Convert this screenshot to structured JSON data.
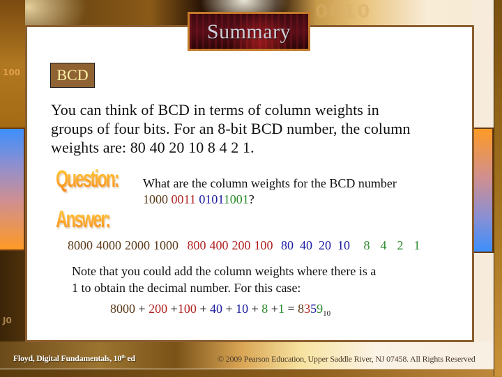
{
  "slide": {
    "title": "Summary",
    "topic_label": "BCD",
    "intro_lines": [
      "You can think of BCD in terms of column weights in",
      "groups of four bits. For an 8-bit BCD number, the column",
      "weights are: 80  40  20  10   8   4   2   1."
    ],
    "question_graphic": "Question:",
    "answer_graphic": "Answer:",
    "question": {
      "line1": "What are the column weights for the BCD number",
      "bcd_groups": [
        "1000",
        "0011",
        "0101",
        "1001"
      ],
      "suffix": "?"
    },
    "answer_weights": [
      {
        "color": "#5a3a1a",
        "values": [
          "8000",
          "4000",
          "2000",
          "1000"
        ]
      },
      {
        "color": "#b22222",
        "values": [
          "800",
          "400",
          "200",
          "100"
        ]
      },
      {
        "color": "#1a1aa0",
        "values": [
          "80",
          "40",
          "20",
          "10"
        ]
      },
      {
        "color": "#2a8a2a",
        "values": [
          "8",
          "4",
          "2",
          "1"
        ]
      }
    ],
    "note_lines": [
      "Note that you could add the column weights where there is a",
      "1 to obtain the decimal number. For this case:"
    ],
    "equation": {
      "terms": [
        {
          "text": "8000",
          "color": "#5a3a1a"
        },
        {
          "text": " + ",
          "color": "#111111"
        },
        {
          "text": "200",
          "color": "#b22222"
        },
        {
          "text": " +",
          "color": "#111111"
        },
        {
          "text": "100",
          "color": "#b22222"
        },
        {
          "text": " + ",
          "color": "#111111"
        },
        {
          "text": "40",
          "color": "#1a1aa0"
        },
        {
          "text": " + ",
          "color": "#111111"
        },
        {
          "text": "10",
          "color": "#1a1aa0"
        },
        {
          "text": " + ",
          "color": "#111111"
        },
        {
          "text": "8",
          "color": "#2a8a2a"
        },
        {
          "text": " +",
          "color": "#111111"
        },
        {
          "text": "1",
          "color": "#2a8a2a"
        },
        {
          "text": " = ",
          "color": "#111111"
        }
      ],
      "result_digits": [
        {
          "text": "8",
          "color": "#5a3a1a"
        },
        {
          "text": "3",
          "color": "#b22222"
        },
        {
          "text": "5",
          "color": "#1a1aa0"
        },
        {
          "text": "9",
          "color": "#2a8a2a"
        }
      ],
      "base": "10"
    }
  },
  "background_codes": [
    "100",
    "J0",
    "0010"
  ],
  "footer": {
    "left_text": "Floyd, Digital Fundamentals, 10",
    "left_sup": "th",
    "left_suffix": " ed",
    "right_text": "© 2009 Pearson Education, Upper Saddle River, NJ 07458. All Rights Reserved"
  },
  "colors": {
    "brown": "#5a3a1a",
    "red": "#b22222",
    "blue": "#1a1aa0",
    "green": "#2a8a2a",
    "label_bg": "#8f6234",
    "label_text": "#fff4a8",
    "panel_border": "#8b5e30"
  }
}
